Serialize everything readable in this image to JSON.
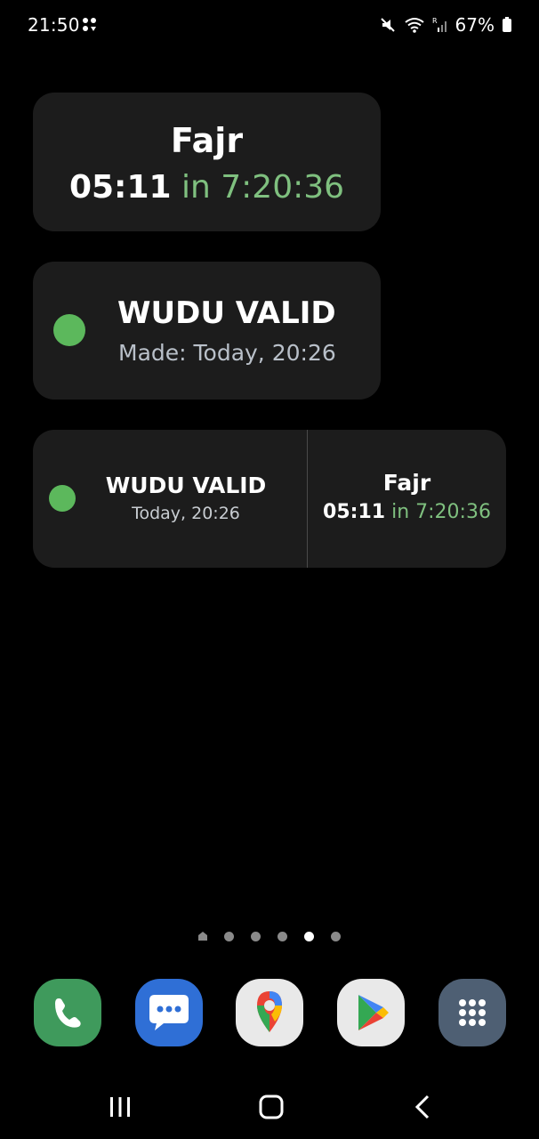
{
  "status_bar": {
    "time": "21:50",
    "battery": "67%",
    "icons": [
      "notification-dots-icon",
      "mute-icon",
      "wifi-icon",
      "signal-icon",
      "battery-icon"
    ]
  },
  "widgets": {
    "next_prayer": {
      "name": "Fajr",
      "time": "05:11",
      "countdown": "in 7:20:36"
    },
    "wudu": {
      "status": "WUDU VALID",
      "made": "Made: Today, 20:26"
    },
    "combined": {
      "wudu_status": "WUDU VALID",
      "wudu_time": "Today, 20:26",
      "prayer_name": "Fajr",
      "prayer_time": "05:11",
      "countdown": "in 7:20:36"
    }
  },
  "colors": {
    "widget_bg": "#1c1c1c",
    "status_green": "#5cb85c",
    "countdown_green": "#7fc07f"
  },
  "page_indicator": {
    "pages": 6,
    "active_index": 4
  },
  "dock": {
    "apps": [
      "phone-icon",
      "messages-icon",
      "maps-icon",
      "play-store-icon",
      "app-drawer-icon"
    ]
  },
  "nav_bar": {
    "buttons": [
      "recents-icon",
      "home-icon",
      "back-icon"
    ]
  }
}
